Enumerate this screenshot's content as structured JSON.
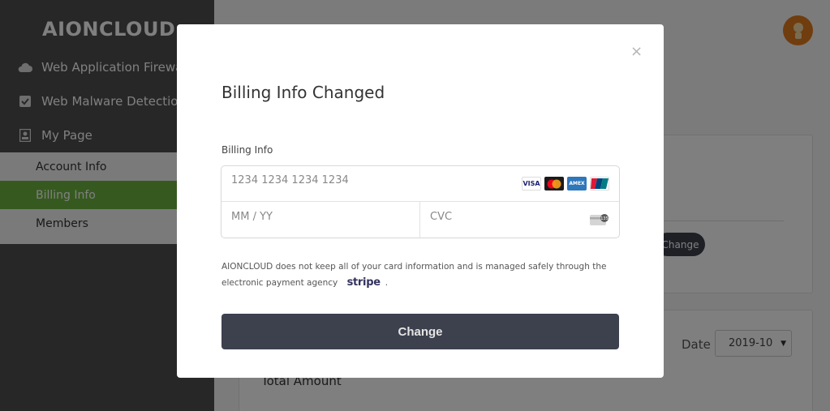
{
  "app": {
    "logo": "AIONCLOUD"
  },
  "sidebar": {
    "items": [
      {
        "label": "Web Application Firewall",
        "icon": "cloud-icon"
      },
      {
        "label": "Web Malware Detection",
        "icon": "checkbox-icon"
      },
      {
        "label": "My Page",
        "icon": "id-card-icon"
      }
    ],
    "submenu": [
      {
        "label": "Account Info",
        "active": false
      },
      {
        "label": "Billing Info",
        "active": true
      },
      {
        "label": "Members",
        "active": false
      }
    ],
    "active_color": "#6db33f"
  },
  "background": {
    "change_label": "Change",
    "date_label": "Date",
    "date_value": "2019-10",
    "total_amount_label": "Total Amount"
  },
  "modal": {
    "close_label": "×",
    "title": "Billing Info Changed",
    "field_label": "Billing Info",
    "card_number_placeholder": "1234 1234 1234 1234",
    "expiry_placeholder": "MM / YY",
    "cvc_placeholder": "CVC",
    "card_brands": [
      "visa-icon",
      "mastercard-icon",
      "amex-icon",
      "unionpay-icon"
    ],
    "brand_visa_text": "VISA",
    "brand_amex_text": "AMEX",
    "cvc_icon_text": "135",
    "notice_line1": "AIONCLOUD does not keep all of your card information and is managed safely through the",
    "notice_line2_prefix": "electronic payment agency",
    "notice_brand": "stripe",
    "notice_suffix": ".",
    "submit_label": "Change"
  }
}
